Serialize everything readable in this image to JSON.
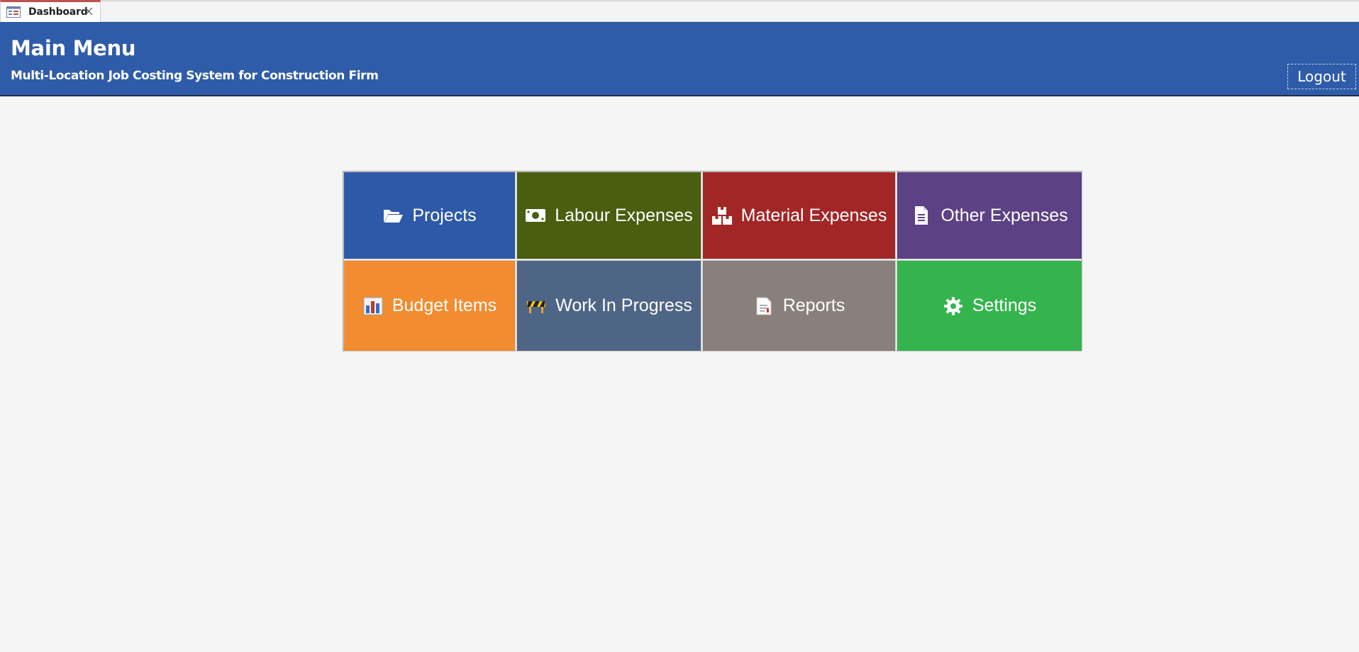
{
  "tab": {
    "label": "Dashboard"
  },
  "header": {
    "title": "Main Menu",
    "subtitle": "Multi-Location Job Costing System for Construction Firm",
    "logout_label": "Logout",
    "background": "#2f5ca8"
  },
  "tiles": [
    {
      "label": "Projects",
      "icon": "folder-open-icon",
      "color": "#2e59a8"
    },
    {
      "label": "Labour Expenses",
      "icon": "money-bill-icon",
      "color": "#4a5e10"
    },
    {
      "label": "Material Expenses",
      "icon": "boxes-icon",
      "color": "#a32626"
    },
    {
      "label": "Other Expenses",
      "icon": "document-icon",
      "color": "#5c4185"
    },
    {
      "label": "Budget Items",
      "icon": "bar-chart-icon",
      "color": "#f28c30"
    },
    {
      "label": "Work In Progress",
      "icon": "construction-barrier-icon",
      "color": "#4f6585"
    },
    {
      "label": "Reports",
      "icon": "report-icon",
      "color": "#8a807b"
    },
    {
      "label": "Settings",
      "icon": "gear-icon",
      "color": "#35b44e"
    }
  ]
}
